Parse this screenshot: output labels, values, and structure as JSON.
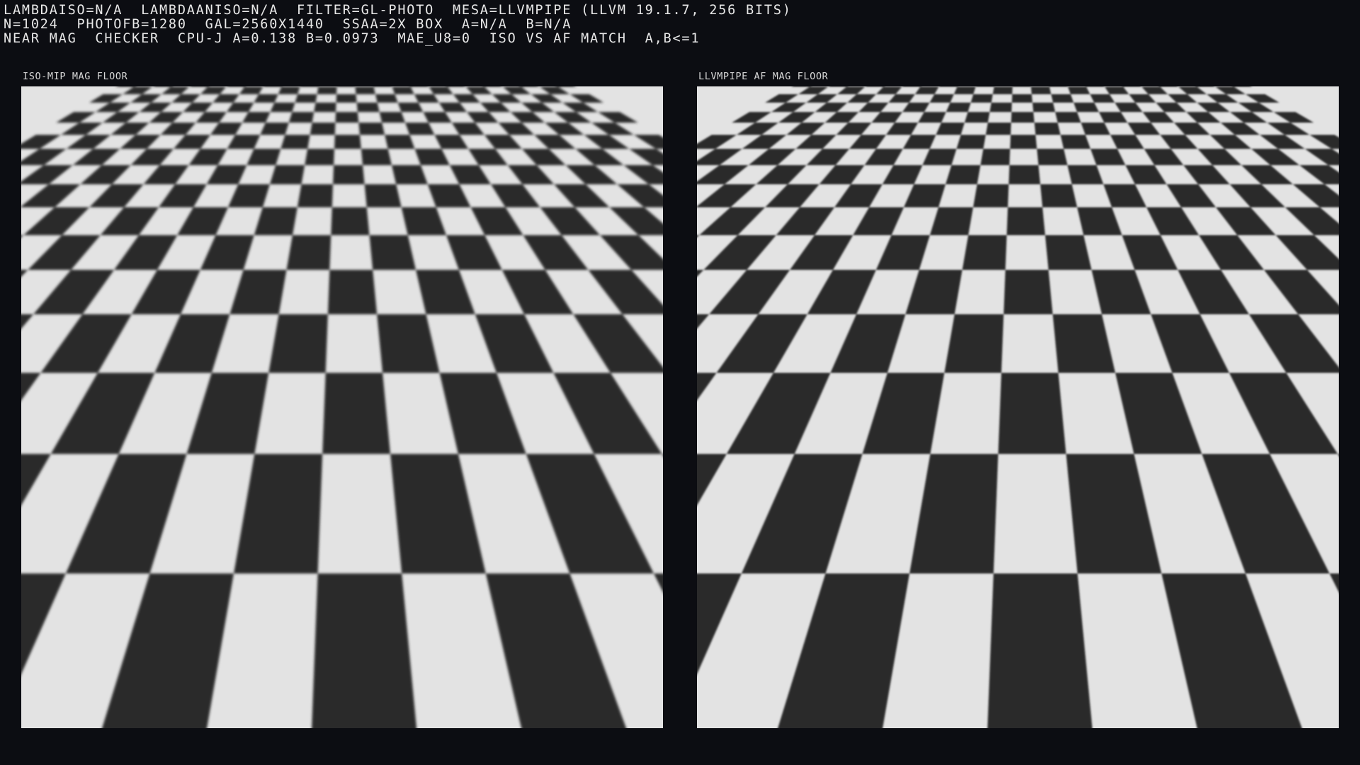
{
  "hud": {
    "lines": [
      "LAMBDAISO=N/A  LAMBDAANISO=N/A  FILTER=GL-PHOTO  MESA=LLVMPIPE (LLVM 19.1.7, 256 BITS)",
      "N=1024  PHOTOFB=1280  GAL=2560X1440  SSAA=2X BOX  A=N/A  B=N/A",
      "NEAR MAG  CHECKER  CPU-J A=0.138 B=0.0973  MAE_U8=0  ISO VS AF MATCH  A,B<=1"
    ]
  },
  "panels": [
    {
      "label": "ISO-MIP MAG FLOOR",
      "filter": "iso",
      "blur": 1.9
    },
    {
      "label": "LLVMPIPE AF MAG FLOOR",
      "filter": "af",
      "blur": 1.3
    }
  ],
  "colors": {
    "background": "#0c0d12",
    "checker_light": "#e3e3e3",
    "checker_dark": "#2b2b2b",
    "text": "#e8e8e8"
  }
}
